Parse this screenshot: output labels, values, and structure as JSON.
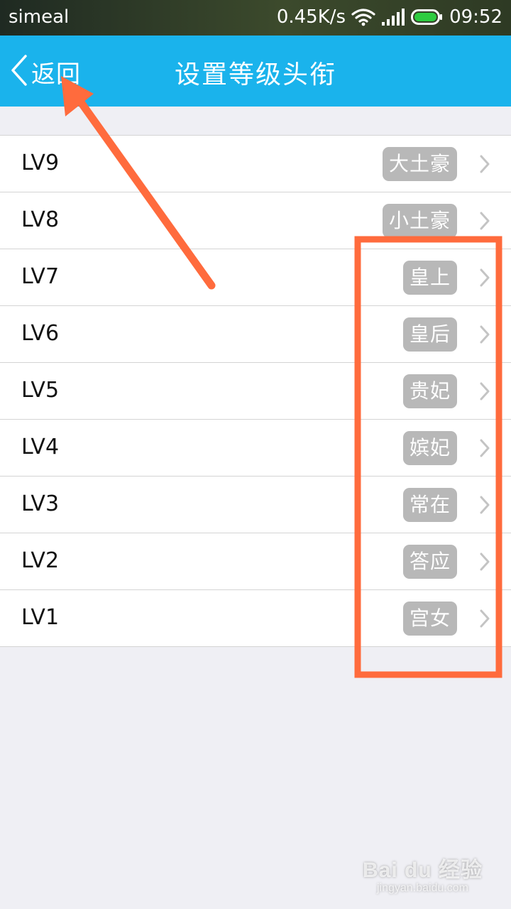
{
  "status_bar": {
    "carrier": "simeal",
    "network_speed": "0.45K/s",
    "time": "09:52",
    "icons": [
      "wifi-icon",
      "signal-icon",
      "battery-icon"
    ],
    "battery_color": "#2ecc40"
  },
  "nav": {
    "back_label": "返回",
    "title": "设置等级头衔",
    "background_color": "#1ab3ec"
  },
  "levels": [
    {
      "level": "LV9",
      "title": "大土豪"
    },
    {
      "level": "LV8",
      "title": "小土豪"
    },
    {
      "level": "LV7",
      "title": "皇上"
    },
    {
      "level": "LV6",
      "title": "皇后"
    },
    {
      "level": "LV5",
      "title": "贵妃"
    },
    {
      "level": "LV4",
      "title": "嫔妃"
    },
    {
      "level": "LV3",
      "title": "常在"
    },
    {
      "level": "LV2",
      "title": "答应"
    },
    {
      "level": "LV1",
      "title": "宫女"
    }
  ],
  "annotation": {
    "color": "#ff6b3d",
    "arrow_target": "back-button",
    "highlight_target": "level-title-badges"
  },
  "watermark": {
    "main": "Bai du 经验",
    "sub": "jingyan.baidu.com"
  }
}
